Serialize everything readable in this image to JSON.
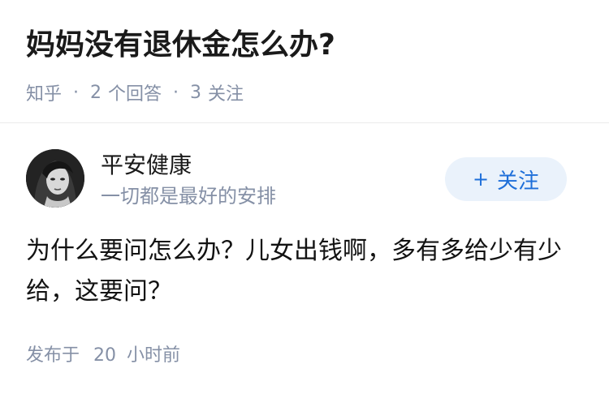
{
  "question": {
    "title": "妈妈没有退休金怎么办?",
    "source": "知乎",
    "answers_count": "2",
    "answers_label": "个回答",
    "followers_count": "3",
    "followers_label": "关注"
  },
  "answer": {
    "author": {
      "name": "平安健康",
      "bio": "一切都是最好的安排",
      "follow_label": "关注",
      "follow_icon": "plus-icon"
    },
    "content": "为什么要问怎么办？儿女出钱啊，多有多给少有少给，这要问？",
    "time_prefix": "发布于",
    "time_value": "20",
    "time_unit": "小时前"
  },
  "colors": {
    "accent": "#1e6fd9",
    "follow_bg": "#eaf2fb",
    "meta_gray": "#8590a6"
  }
}
